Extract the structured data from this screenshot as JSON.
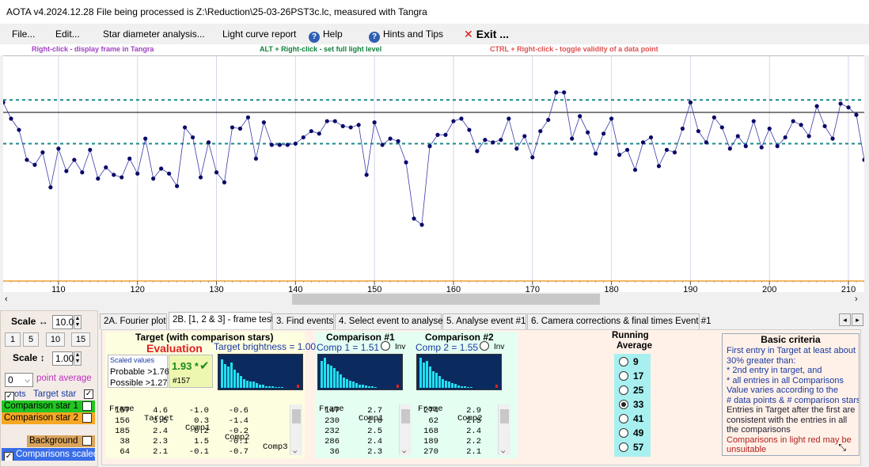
{
  "titlebar": {
    "title": "AOTA v4.2024.12.28    File being processed is Z:\\Reduction\\25-03-26PST3c.lc, measured with Tangra"
  },
  "menu": {
    "file": "File...",
    "edit": "Edit...",
    "star_diameter": "Star diameter analysis...",
    "lightcurve_report": "Light curve report",
    "help": "Help",
    "hints": "Hints and Tips",
    "exit": "Exit ..."
  },
  "hints": {
    "right_click": "Right-click  -  display frame in Tangra",
    "alt_right_click": "ALT + Right-click  -  set full light level",
    "ctrl_right_click": "CTRL + Right-click  -  toggle validity of a data point"
  },
  "colors": {
    "hint1": "#a040c0",
    "hint2": "#10803a",
    "hint3": "#e05050",
    "plot_line": "#3a3aaa",
    "plot_point": "#0a0a6a",
    "dashed": "#1a8a8a",
    "tick_axis": "#f0a030"
  },
  "chart_data": {
    "type": "line",
    "x": [
      103,
      104,
      105,
      106,
      107,
      108,
      109,
      110,
      111,
      112,
      113,
      114,
      115,
      116,
      117,
      118,
      119,
      120,
      121,
      122,
      123,
      124,
      125,
      126,
      127,
      128,
      129,
      130,
      131,
      132,
      133,
      134,
      135,
      136,
      137,
      138,
      139,
      140,
      141,
      142,
      143,
      144,
      145,
      146,
      147,
      148,
      149,
      150,
      151,
      152,
      153,
      154,
      155,
      156,
      157,
      158,
      159,
      160,
      161,
      162,
      163,
      164,
      165,
      166,
      167,
      168,
      169,
      170,
      171,
      172,
      173,
      174,
      175,
      176,
      177,
      178,
      179,
      180,
      181,
      182,
      183,
      184,
      185,
      186,
      187,
      188,
      189,
      190,
      191,
      192,
      193,
      194,
      195,
      196,
      197,
      198,
      199,
      200,
      201,
      202,
      203,
      204,
      205,
      206,
      207,
      208,
      209,
      210,
      211,
      212
    ],
    "y": [
      1.08,
      0.95,
      0.86,
      0.62,
      0.58,
      0.68,
      0.4,
      0.71,
      0.53,
      0.62,
      0.52,
      0.7,
      0.47,
      0.56,
      0.5,
      0.48,
      0.63,
      0.51,
      0.79,
      0.47,
      0.55,
      0.51,
      0.41,
      0.88,
      0.8,
      0.48,
      0.76,
      0.52,
      0.44,
      0.88,
      0.87,
      0.96,
      0.63,
      0.92,
      0.74,
      0.74,
      0.74,
      0.75,
      0.8,
      0.85,
      0.83,
      0.93,
      0.93,
      0.89,
      0.88,
      0.9,
      0.5,
      0.92,
      0.74,
      0.79,
      0.77,
      0.6,
      0.15,
      0.1,
      0.73,
      0.82,
      0.82,
      0.93,
      0.95,
      0.86,
      0.69,
      0.78,
      0.76,
      0.78,
      0.95,
      0.71,
      0.81,
      0.64,
      0.85,
      0.94,
      1.16,
      1.16,
      0.79,
      0.97,
      0.84,
      0.67,
      0.83,
      0.95,
      0.66,
      0.7,
      0.54,
      0.76,
      0.8,
      0.57,
      0.7,
      0.68,
      0.87,
      1.08,
      0.85,
      0.76,
      0.96,
      0.88,
      0.71,
      0.81,
      0.73,
      0.93,
      0.72,
      0.87,
      0.73,
      0.8,
      0.93,
      0.9,
      0.81,
      1.05,
      0.89,
      0.79,
      1.07,
      1.04,
      0.98,
      0.62
    ],
    "x_ticks": [
      110,
      120,
      130,
      140,
      150,
      160,
      170,
      180,
      190,
      200,
      210
    ],
    "full_level": 1.0,
    "band_upper": 1.1,
    "band_lower": 0.75,
    "xlim": [
      103,
      212
    ],
    "ylim": [
      -0.35,
      1.45
    ],
    "grid": true
  },
  "tabs": [
    {
      "label": "2A. Fourier plot"
    },
    {
      "label": "2B. [1, 2 & 3] - frame test"
    },
    {
      "label": "3. Find events"
    },
    {
      "label": "4. Select event to analyse"
    },
    {
      "label": "5. Analyse event #1"
    },
    {
      "label": "6. Camera corrections & final times Event #1"
    }
  ],
  "left": {
    "scale_h_label": "Scale ↔",
    "scale_h_value": "10.0",
    "presets": [
      "1",
      "5",
      "10",
      "15"
    ],
    "scale_v_label": "Scale ↕",
    "scale_v_value": "1.00",
    "point_avg_value": "0",
    "point_avg_label": "point average",
    "pts_label": "ots",
    "target_label": "Target star",
    "comp1_label": "Comparison star 1",
    "comp2_label": "Comparison star 2",
    "background_label": "Background",
    "comps_scaled_label": "Comparisons scaled"
  },
  "target": {
    "header": "Target (with comparison stars)",
    "evaluation": "Evaluation",
    "brightness": "Target  brightness = 1.00",
    "scaled_values": "Scaled values",
    "probable": "Probable >1.76",
    "possible": "Possible  >1.27",
    "score": "1.93 *",
    "frame_ref": "#157",
    "columns": [
      "Frame",
      "Target",
      "Comp1",
      "Comp2",
      "Comp3"
    ],
    "rows": [
      [
        "157",
        "4.6",
        "-1.0",
        "-0.6"
      ],
      [
        "156",
        "3.5",
        "0.3",
        "-1.4"
      ],
      [
        "185",
        "2.4",
        "-0.2",
        "-0.2"
      ],
      [
        "38",
        "2.3",
        "1.5",
        "-0.1"
      ],
      [
        "64",
        "2.1",
        "-0.1",
        "-0.7"
      ]
    ],
    "hist": [
      0.95,
      0.8,
      0.7,
      0.85,
      0.6,
      0.5,
      0.4,
      0.3,
      0.25,
      0.2,
      0.2,
      0.15,
      0.1,
      0.1,
      0.05,
      0.05,
      0.05,
      0.03,
      0.03,
      0.03
    ]
  },
  "comp1": {
    "header": "Comparison #1",
    "sub": "Comp 1 = 1.51",
    "inv": "Inv",
    "columns": [
      "Frame",
      "Comp1"
    ],
    "rows": [
      [
        "147",
        "2.7"
      ],
      [
        "230",
        "2.6"
      ],
      [
        "232",
        "2.5"
      ],
      [
        "286",
        "2.4"
      ],
      [
        "36",
        "2.3"
      ]
    ],
    "hist": [
      0.9,
      1.0,
      0.8,
      0.75,
      0.65,
      0.55,
      0.45,
      0.35,
      0.3,
      0.25,
      0.2,
      0.15,
      0.1,
      0.1,
      0.08,
      0.05,
      0.05,
      0.03
    ]
  },
  "comp2": {
    "header": "Comparison #2",
    "sub": "Comp 2 = 1.55",
    "inv": "Inv",
    "columns": [
      "Frame",
      "Comp2"
    ],
    "rows": [
      [
        "274",
        "2.9"
      ],
      [
        "62",
        "2.5"
      ],
      [
        "168",
        "2.4"
      ],
      [
        "189",
        "2.2"
      ],
      [
        "270",
        "2.1"
      ]
    ],
    "hist": [
      1.0,
      0.85,
      0.9,
      0.7,
      0.55,
      0.5,
      0.4,
      0.3,
      0.25,
      0.2,
      0.15,
      0.12,
      0.08,
      0.05,
      0.05,
      0.03,
      0.03
    ]
  },
  "running_average": {
    "title1": "Running",
    "title2": "Average",
    "options": [
      "9",
      "17",
      "25",
      "33",
      "41",
      "49",
      "57"
    ],
    "selected": "33"
  },
  "criteria": {
    "title": "Basic criteria",
    "lines": [
      {
        "text": "First entry in Target at least about",
        "color": "#1a3aa0"
      },
      {
        "text": "30% greater than:",
        "color": "#1a3aa0"
      },
      {
        "text": "*  2nd  entry in target, and",
        "color": "#1a3aa0"
      },
      {
        "text": "*  all entries in all Comparisons",
        "color": "#1a3aa0"
      },
      {
        "text": "Value varies according to the",
        "color": "#1a3aa0"
      },
      {
        "text": "# data points & # comparison stars",
        "color": "#1a3aa0"
      },
      {
        "text": "Entries in Target after the first are",
        "color": "#223"
      },
      {
        "text": "consistent with the entries in all",
        "color": "#223"
      },
      {
        "text": "the comparisons",
        "color": "#223"
      },
      {
        "text": "Comparisons in light red may be",
        "color": "#b02020"
      },
      {
        "text": "unsuitable",
        "color": "#b02020"
      }
    ]
  }
}
